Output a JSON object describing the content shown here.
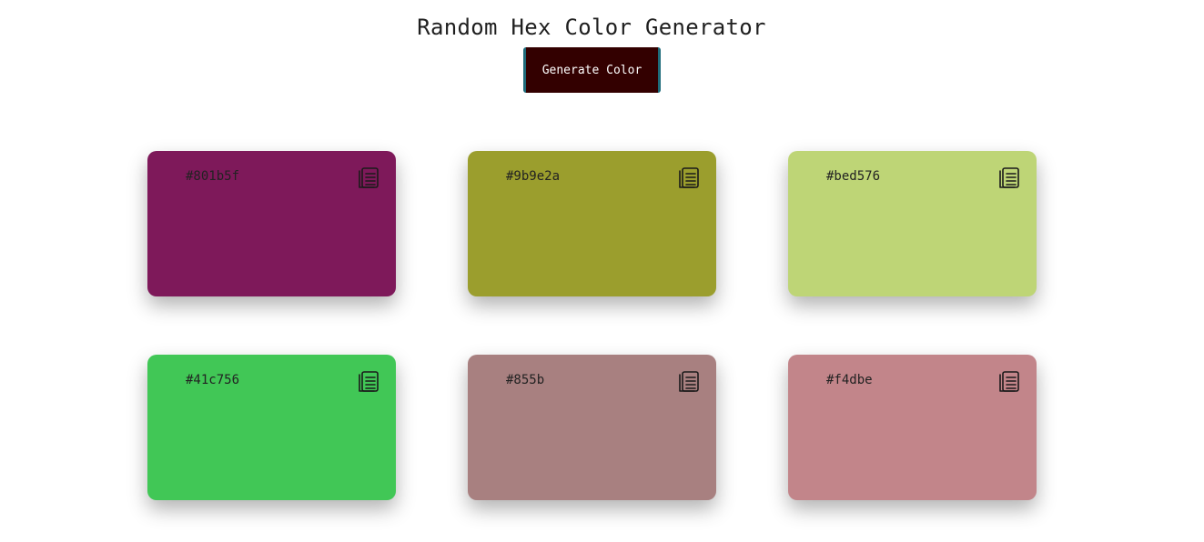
{
  "header": {
    "title": "Random Hex Color Generator"
  },
  "generate_button": {
    "label": "Generate Color",
    "color": "#330000",
    "accent": "#1e6b7a"
  },
  "cards": [
    {
      "hex": "#801b5f",
      "color": "#7e195a",
      "icon": "copy-icon"
    },
    {
      "hex": "#9b9e2a",
      "color": "#9b9e2d",
      "icon": "copy-icon"
    },
    {
      "hex": "#bed576",
      "color": "#bed576",
      "icon": "copy-icon"
    },
    {
      "hex": "#41c756",
      "color": "#41c756",
      "icon": "copy-icon"
    },
    {
      "hex": "#855b",
      "color": "#a88080",
      "icon": "copy-icon"
    },
    {
      "hex": "#f4dbe",
      "color": "#c2858a",
      "icon": "copy-icon"
    }
  ]
}
